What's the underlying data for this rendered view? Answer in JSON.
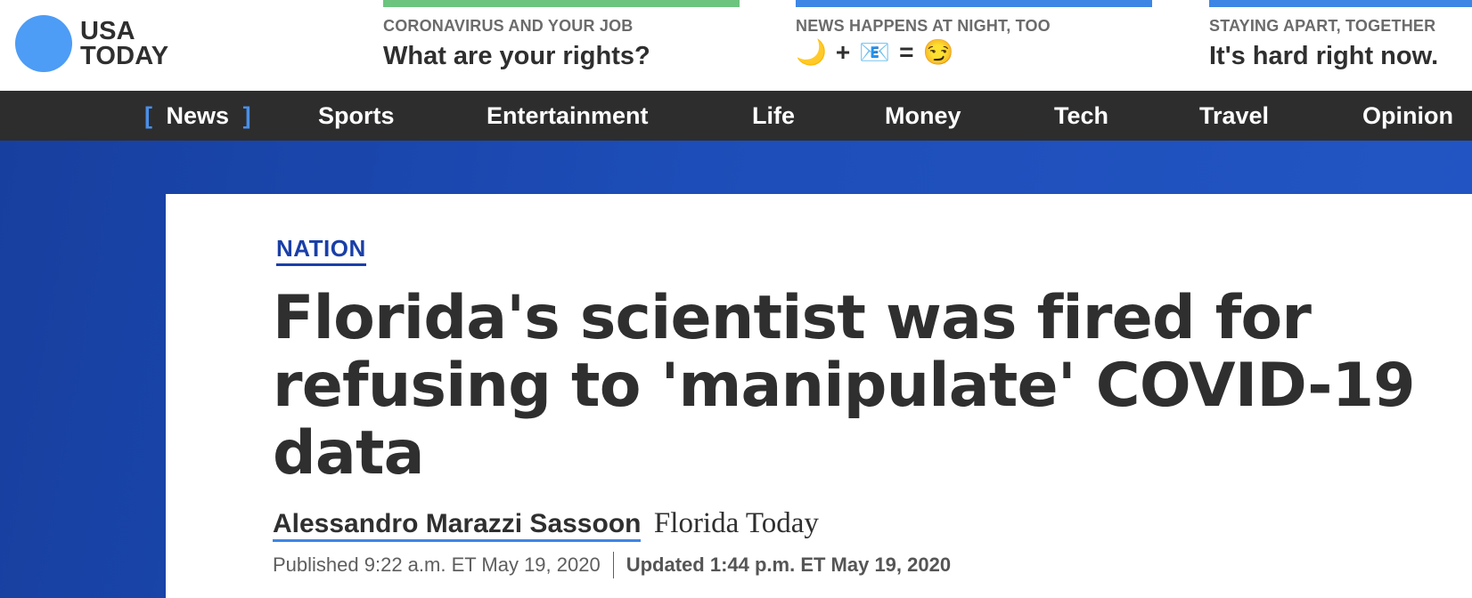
{
  "brand": {
    "logo_line1": "USA",
    "logo_line2": "TODAY",
    "logo_dot_color": "#4d9cf5"
  },
  "promos": [
    {
      "kicker": "CORONAVIRUS AND YOUR JOB",
      "headline": "What are your rights?",
      "bar_color": "#6cc47e"
    },
    {
      "kicker": "NEWS HAPPENS AT NIGHT, TOO",
      "emoji_sequence": [
        "🌙",
        "+",
        "📧",
        "=",
        "😏"
      ],
      "bar_color": "#3d86e6"
    },
    {
      "kicker": "STAYING APART, TOGETHER",
      "headline": "It's hard right now.",
      "bar_color": "#3d86e6"
    }
  ],
  "nav": {
    "active_open": "[",
    "active_close": "]",
    "items": [
      "News",
      "Sports",
      "Entertainment",
      "Life",
      "Money",
      "Tech",
      "Travel",
      "Opinion"
    ],
    "active_index": 0,
    "active_bracket_color": "#4a8fe7"
  },
  "article": {
    "category": "NATION",
    "headline": "Florida's scientist was fired for refusing to 'manipulate' COVID-19 data",
    "author": "Alessandro Marazzi Sassoon",
    "source": "Florida Today",
    "published": "Published 9:22 a.m. ET May 19, 2020",
    "updated": "Updated 1:44 p.m. ET May 19, 2020"
  },
  "colors": {
    "nav_background": "#2d2d2d",
    "hero_blue": "#1d4db8",
    "category_blue": "#1a3fa8",
    "author_underline": "#3d86e6"
  }
}
